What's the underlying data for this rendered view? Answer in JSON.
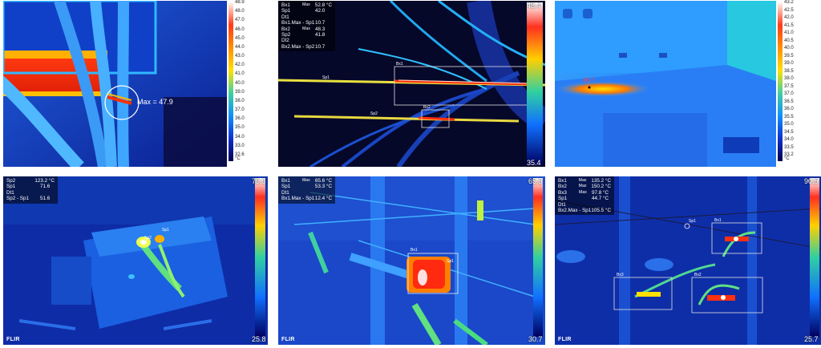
{
  "panel1": {
    "max_label": "Max = 47.9",
    "scale_ticks": [
      "48.9",
      "48.0",
      "47.0",
      "46.0",
      "45.0",
      "44.0",
      "43.0",
      "42.0",
      "41.0",
      "40.0",
      "39.0",
      "38.0",
      "37.0",
      "36.0",
      "35.0",
      "34.0",
      "33.0",
      "32.6"
    ],
    "unit": "°C"
  },
  "panel2": {
    "readout": [
      {
        "k": "Bx1",
        "m": "Max",
        "v": "52.8 °C"
      },
      {
        "k": "Sp1",
        "m": "",
        "v": "42.0"
      },
      {
        "k": "Dt1",
        "m": "",
        "v": ""
      },
      {
        "k": "Bx1.Max - Sp1",
        "m": "",
        "v": "10.7"
      },
      {
        "k": "Bx2",
        "m": "Max",
        "v": "48.3"
      },
      {
        "k": "Sp2",
        "m": "",
        "v": "41.8"
      },
      {
        "k": "Dt2",
        "m": "",
        "v": ""
      },
      {
        "k": "Bx2.Max - Sp2",
        "m": "",
        "v": "10.7"
      }
    ],
    "scale_max": "48.4",
    "scale_min": "35.4",
    "spots": [
      "Sp1",
      "Sp2",
      "Bx1",
      "Bx2"
    ]
  },
  "panel3": {
    "point_value": "38.7",
    "scale_ticks": [
      "43.2",
      "42.5",
      "42.0",
      "41.5",
      "41.0",
      "40.5",
      "40.0",
      "39.5",
      "39.0",
      "38.5",
      "38.0",
      "37.5",
      "37.0",
      "36.5",
      "36.0",
      "35.5",
      "35.0",
      "34.5",
      "34.0",
      "33.5",
      "33.2"
    ],
    "unit": "°C"
  },
  "panel4": {
    "readout": [
      {
        "k": "Sp2",
        "m": "",
        "v": "123.2 °C"
      },
      {
        "k": "Sp1",
        "m": "",
        "v": "71.6"
      },
      {
        "k": "Dt1",
        "m": "",
        "v": ""
      },
      {
        "k": "Sp2 - Sp1",
        "m": "",
        "v": "51.6"
      }
    ],
    "scale_max": "79.3",
    "scale_min": "25.8",
    "spots": [
      "Sp2",
      "Sp1"
    ],
    "brand": "FLIR"
  },
  "panel5": {
    "readout": [
      {
        "k": "Bx1",
        "m": "Max",
        "v": "65.6 °C"
      },
      {
        "k": "Sp1",
        "m": "",
        "v": "53.3 °C"
      },
      {
        "k": "Dt1",
        "m": "",
        "v": ""
      },
      {
        "k": "Bx1.Max - Sp1",
        "m": "",
        "v": "12.4 °C"
      }
    ],
    "scale_max": "65.5",
    "scale_min": "30.7",
    "spots": [
      "Bx1",
      "Sp1"
    ],
    "brand": "FLIR"
  },
  "panel6": {
    "readout": [
      {
        "k": "Bx1",
        "m": "Max",
        "v": "135.2 °C"
      },
      {
        "k": "Bx2",
        "m": "Max",
        "v": "150.2 °C"
      },
      {
        "k": "Bx3",
        "m": "Max",
        "v": "97.8 °C"
      },
      {
        "k": "Sp1",
        "m": "",
        "v": "44.7 °C"
      },
      {
        "k": "Dt1",
        "m": "",
        "v": ""
      },
      {
        "k": "Bx2.Max - Sp1",
        "m": "",
        "v": "105.5 °C"
      }
    ],
    "scale_max": "90.5",
    "scale_min": "25.7",
    "spots": [
      "Sp1",
      "Bx1",
      "Bx2",
      "Bx3"
    ],
    "brand": "FLIR"
  }
}
